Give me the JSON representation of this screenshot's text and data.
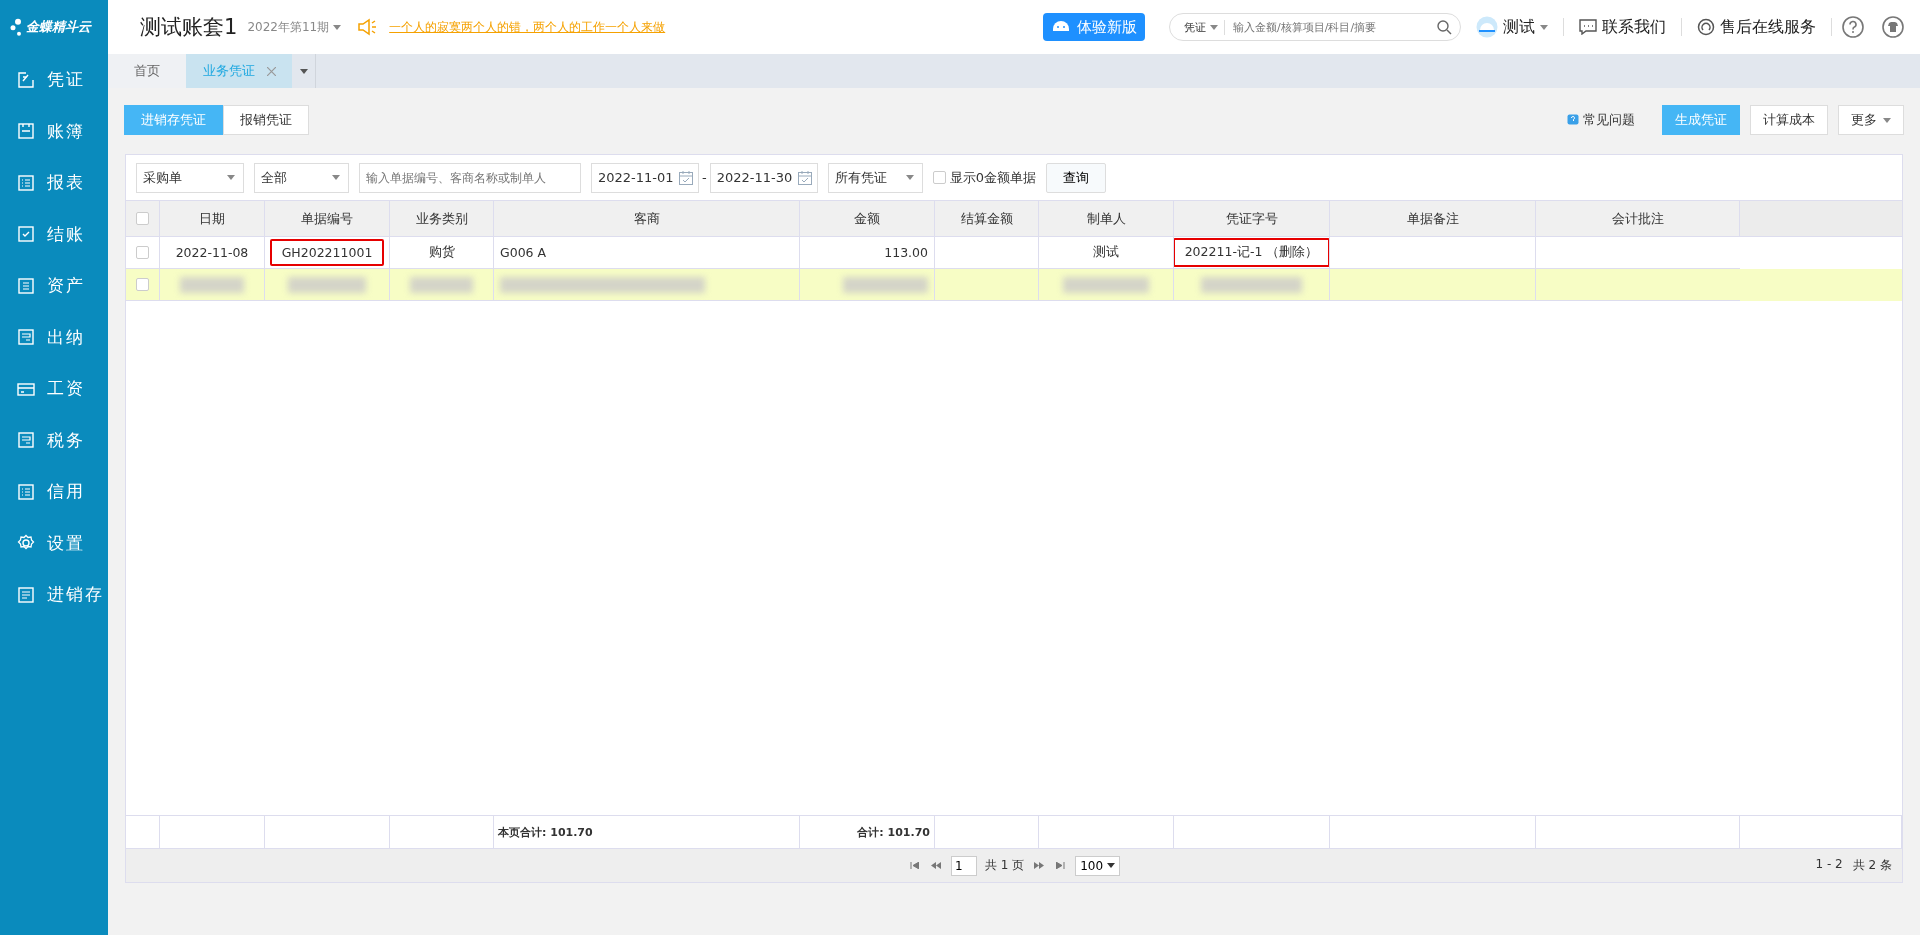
{
  "logo": {
    "text": "金蝶精斗云"
  },
  "header": {
    "title": "测试账套1",
    "period": "2022年第11期",
    "notice": "一个人的寂寞两个人的错，两个人的工作一个人来做",
    "new_version_button": "体验新版",
    "search": {
      "scope": "凭证",
      "placeholder": "输入金额/核算项目/科目/摘要"
    },
    "user": "测试",
    "contact": "联系我们",
    "service": "售后在线服务"
  },
  "sidebar": {
    "items": [
      {
        "label": "凭证",
        "selected": false
      },
      {
        "label": "账簿",
        "selected": false
      },
      {
        "label": "报表",
        "selected": false
      },
      {
        "label": "结账",
        "selected": false
      },
      {
        "label": "资产",
        "selected": false
      },
      {
        "label": "出纳",
        "selected": false
      },
      {
        "label": "工资",
        "selected": false
      },
      {
        "label": "税务",
        "selected": false
      },
      {
        "label": "信用",
        "selected": false
      },
      {
        "label": "设置",
        "selected": false
      },
      {
        "label": "进销存",
        "selected": false
      }
    ]
  },
  "tabs": [
    {
      "label": "首页",
      "selected": false,
      "closable": false
    },
    {
      "label": "业务凭证",
      "selected": true,
      "closable": true
    }
  ],
  "table_select_all": {
    "checked": false
  },
  "subtabs": [
    {
      "label": "进销存凭证",
      "selected": true
    },
    {
      "label": "报销凭证",
      "selected": false
    }
  ],
  "actions": {
    "faq": "常见问题",
    "buttons": [
      {
        "label": "生成凭证",
        "kind": "primary"
      },
      {
        "label": "计算成本",
        "kind": "plain"
      },
      {
        "label": "更多",
        "kind": "dropdown"
      }
    ]
  },
  "filters": {
    "doc_type": "采购单",
    "category": "全部",
    "keyword_placeholder": "输入单据编号、客商名称或制单人",
    "date_from": "2022-11-01",
    "date_to": "2022-11-30",
    "date_separator": "-",
    "voucher_filter": "所有凭证",
    "show_zero": {
      "label": "显示0金额单据",
      "checked": false
    },
    "query_button": "查询"
  },
  "table": {
    "columns": [
      "日期",
      "单据编号",
      "业务类别",
      "客商",
      "金额",
      "结算金额",
      "制单人",
      "凭证字号",
      "单据备注",
      "会计批注"
    ],
    "rows": [
      {
        "selected": false,
        "checked": false,
        "cells": [
          {
            "kind": "text",
            "text": "2022-11-08",
            "outlined": false
          },
          {
            "kind": "text",
            "text": "GH202211001",
            "outlined": true
          },
          {
            "kind": "text",
            "text": "购货",
            "outlined": false
          },
          {
            "kind": "text",
            "text": "G006 A",
            "outlined": false
          },
          {
            "kind": "text",
            "text": "113.00",
            "outlined": false
          },
          {
            "kind": "empty"
          },
          {
            "kind": "text",
            "text": "测试",
            "outlined": false
          },
          {
            "kind": "text",
            "text": "202211-记-1 （删除）",
            "outlined": true
          },
          {
            "kind": "empty"
          },
          {
            "kind": "empty"
          }
        ]
      },
      {
        "selected": true,
        "checked": false,
        "cells": [
          {
            "kind": "blur"
          },
          {
            "kind": "blur"
          },
          {
            "kind": "blur"
          },
          {
            "kind": "blur"
          },
          {
            "kind": "blur"
          },
          {
            "kind": "empty"
          },
          {
            "kind": "blur"
          },
          {
            "kind": "blur"
          },
          {
            "kind": "empty"
          },
          {
            "kind": "empty"
          }
        ]
      }
    ],
    "page_total": "本页合计: 101.70",
    "grand_total": "合计: 101.70"
  },
  "pager": {
    "page": "1",
    "page_count": "共 1 页",
    "page_size": "100",
    "range": "1 - 2",
    "total": "共 2 条"
  }
}
